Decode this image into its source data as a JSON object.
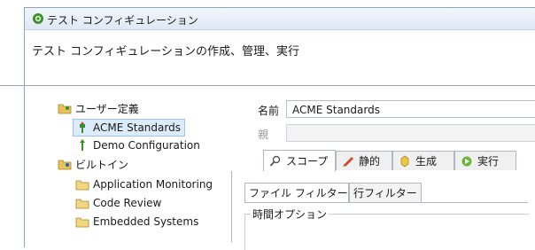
{
  "window": {
    "title": "テスト コンフィギュレーション",
    "icon": "gear-icon"
  },
  "header": {
    "description": "テスト コンフィギュレーションの作成、管理、実行"
  },
  "tree": {
    "groups": [
      {
        "label": "ユーザー定義",
        "icon": "user-folder-icon",
        "items": [
          {
            "label": "ACME Standards",
            "icon": "config-icon",
            "selected": true
          },
          {
            "label": "Demo Configuration",
            "icon": "config-icon",
            "selected": false
          }
        ]
      },
      {
        "label": "ビルトイン",
        "icon": "builtin-folder-icon",
        "items": [
          {
            "label": "Application Monitoring",
            "icon": "folder-icon"
          },
          {
            "label": "Code Review",
            "icon": "folder-icon"
          },
          {
            "label": "Embedded Systems",
            "icon": "folder-icon"
          }
        ]
      }
    ]
  },
  "form": {
    "name_label": "名前",
    "name_value": "ACME Standards",
    "parent_label": "親",
    "parent_value": ""
  },
  "tabs": [
    {
      "label": "スコープ",
      "icon": "scope-icon",
      "active": true
    },
    {
      "label": "静的",
      "icon": "static-icon",
      "active": false
    },
    {
      "label": "生成",
      "icon": "generate-icon",
      "active": false
    },
    {
      "label": "実行",
      "icon": "execute-icon",
      "active": false
    }
  ],
  "subtabs": [
    {
      "label": "ファイル フィルター",
      "active": true
    },
    {
      "label": "行フィルター",
      "active": false
    }
  ],
  "group": {
    "label": "時間オプション"
  },
  "colors": {
    "frame_border": "#8aa4c8",
    "selection_bg": "#dcecfc",
    "selection_border": "#9cc4ec"
  }
}
